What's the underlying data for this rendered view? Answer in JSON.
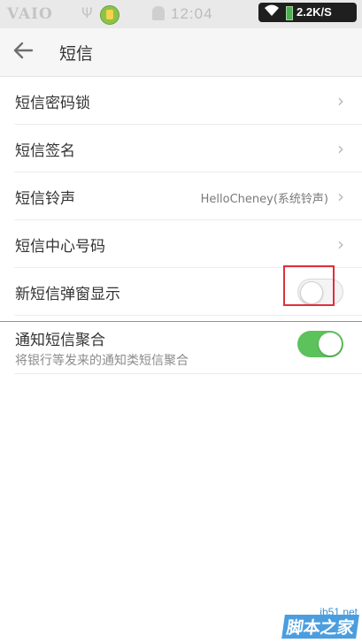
{
  "status_bar": {
    "brand_logo": "VAIO",
    "time": "12:04",
    "net_speed": "2.2K/S"
  },
  "app_bar": {
    "title": "短信"
  },
  "settings": [
    {
      "label": "短信密码锁"
    },
    {
      "label": "短信签名"
    },
    {
      "label": "短信铃声",
      "value": "HelloCheney(系统铃声)"
    },
    {
      "label": "短信中心号码"
    },
    {
      "label": "新短信弹窗显示",
      "toggle": "off"
    },
    {
      "label": "通知短信聚合",
      "sublabel": "将银行等发来的通知类短信聚合",
      "toggle": "on"
    }
  ],
  "colors": {
    "toggle_on": "#5cc25b",
    "highlight": "#e0303a"
  },
  "icons": [
    "back-arrow-icon",
    "chevron-right-icon",
    "wifi-icon",
    "battery-icon",
    "usb-icon",
    "android-icon"
  ],
  "watermark": {
    "site": "jb51.net",
    "brand": "脚本之家"
  }
}
